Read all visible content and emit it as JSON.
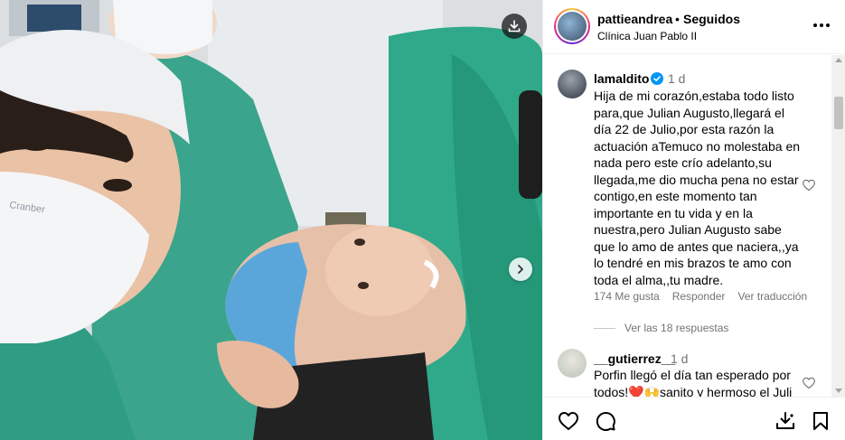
{
  "post": {
    "username": "pattieandrea",
    "separator": "•",
    "follow_status": "Seguidos",
    "location": "Clínica Juan Pablo II"
  },
  "photo": {
    "mask_print": "Cranber"
  },
  "comments": [
    {
      "username": "lamaldito",
      "verified": true,
      "time": "1 d",
      "text": "Hija de mi corazón,estaba todo listo para,que Julian Augusto,llegará el día 22 de Julio,por esta razón la actuación aTemuco no molestaba en nada pero este crío adelanto,su llegada,me dio mucha pena no estar contigo,en este momento tan importante en tu vida y en la nuestra,pero Julian Augusto sabe que lo amo de antes que naciera,,ya lo tendré en mis brazos te amo con toda el alma,,tu madre.",
      "likes": "174 Me gusta",
      "reply_label": "Responder",
      "translate_label": "Ver traducción",
      "view_replies": "Ver las 18 respuestas"
    },
    {
      "username": "__gutierrez__",
      "time": "1 d",
      "text": "Porfin llegó el día tan esperado por todos!❤️🙌sanito y hermoso el Juli"
    }
  ],
  "icons": {
    "download": "download-icon",
    "next": "chevron-right-icon",
    "more": "more-options-icon",
    "like": "heart-icon",
    "comment": "comment-icon",
    "share": "share-icon",
    "save": "bookmark-icon"
  }
}
